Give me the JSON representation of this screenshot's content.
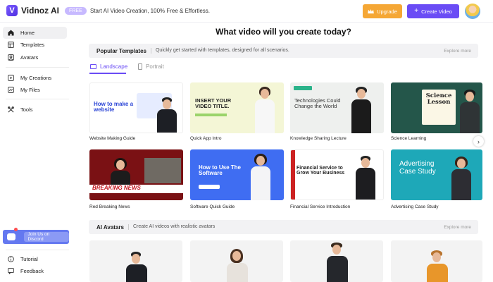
{
  "header": {
    "logo_mark": "V",
    "logo_text": "Vidnoz AI",
    "badge": "FREE",
    "tagline": "Start AI Video Creation, 100% Free & Effortless.",
    "upgrade_label": "Upgrade",
    "create_label": "Create Video",
    "accent_color": "#6a4cf5",
    "upgrade_color": "#f5a735"
  },
  "sidebar": {
    "items": [
      {
        "label": "Home",
        "icon": "home-icon"
      },
      {
        "label": "Templates",
        "icon": "templates-icon"
      },
      {
        "label": "Avatars",
        "icon": "avatars-icon"
      },
      {
        "label": "My Creations",
        "icon": "play-icon"
      },
      {
        "label": "My Files",
        "icon": "folder-icon"
      },
      {
        "label": "Tools",
        "icon": "tools-icon"
      }
    ],
    "discord_label": "Join Us on Discord",
    "bottom_items": [
      {
        "label": "Tutorial",
        "icon": "info-icon"
      },
      {
        "label": "Feedback",
        "icon": "feedback-icon"
      }
    ]
  },
  "main": {
    "title": "What video will you create today?",
    "templates_section": {
      "title": "Popular Templates",
      "description": "Quickly get started with templates, designed for all scenarios.",
      "explore": "Explore more"
    },
    "tabs": [
      {
        "label": "Landscape",
        "active": true
      },
      {
        "label": "Portrait",
        "active": false
      }
    ],
    "templates": [
      {
        "caption": "Website Making Guide",
        "thumb_text": "How to make a website"
      },
      {
        "caption": "Quick App Intro",
        "thumb_text": "INSERT YOUR VIDEO TITLE."
      },
      {
        "caption": "Knowledge Sharing Lecture",
        "thumb_text": "Technologies Could Change the World"
      },
      {
        "caption": "Science Learning",
        "thumb_text": "Science Lesson"
      },
      {
        "caption": "Red Breaking News",
        "thumb_text": "BREAKING NEWS"
      },
      {
        "caption": "Software Quick Guide",
        "thumb_text": "How to Use The Software"
      },
      {
        "caption": "Financial Service Introduction",
        "thumb_text": "Financial Service to Grow Your Business"
      },
      {
        "caption": "Advertising Case Study",
        "thumb_text": "Advertising Case Study"
      }
    ],
    "avatars_section": {
      "title": "AI Avatars",
      "description": "Create AI videos with realistic avatars",
      "explore": "Explore more"
    }
  }
}
